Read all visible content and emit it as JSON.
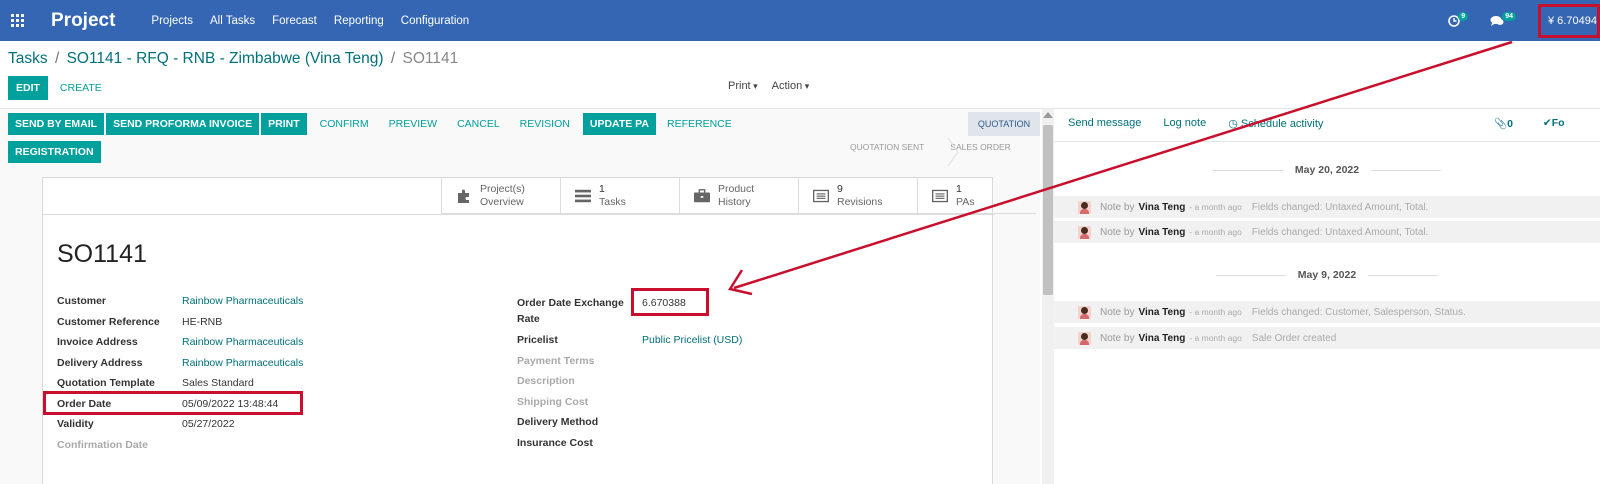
{
  "navbar": {
    "brand": "Project",
    "menu": [
      "Projects",
      "All Tasks",
      "Forecast",
      "Reporting",
      "Configuration"
    ],
    "activity_badge": "9",
    "messages_badge": "94",
    "currency_rate": "¥ 6.70494"
  },
  "breadcrumb": {
    "items": [
      "Tasks",
      "SO1141 - RFQ - RNB - Zimbabwe (Vina Teng)"
    ],
    "current": "SO1141"
  },
  "controls": {
    "edit": "EDIT",
    "create": "CREATE",
    "print": "Print",
    "action": "Action"
  },
  "header_buttons": {
    "send_by_email": "SEND BY EMAIL",
    "send_proforma": "SEND PROFORMA INVOICE",
    "print": "PRINT",
    "confirm": "CONFIRM",
    "preview": "PREVIEW",
    "cancel": "CANCEL",
    "revision": "REVISION",
    "update_pa": "UPDATE PA",
    "reference": "REFERENCE",
    "registration": "REGISTRATION"
  },
  "status": {
    "current": "QUOTATION",
    "stages": [
      "QUOTATION SENT",
      "SALES ORDER"
    ]
  },
  "smart_buttons": [
    {
      "num": "",
      "label1": "Project(s)",
      "label2": "Overview"
    },
    {
      "num": "1",
      "label1": "",
      "label2": "Tasks"
    },
    {
      "num": "",
      "label1": "Product",
      "label2": "History"
    },
    {
      "num": "9",
      "label1": "",
      "label2": "Revisions"
    },
    {
      "num": "1",
      "label1": "",
      "label2": "PAs"
    }
  ],
  "order": {
    "name": "SO1141",
    "left_fields": [
      {
        "label": "Customer",
        "value": "Rainbow Pharmaceuticals"
      },
      {
        "label": "Customer Reference",
        "value": "HE-RNB"
      },
      {
        "label": "Invoice Address",
        "value": "Rainbow Pharmaceuticals"
      },
      {
        "label": "Delivery Address",
        "value": "Rainbow Pharmaceuticals"
      },
      {
        "label": "Quotation Template",
        "value": "Sales Standard"
      },
      {
        "label": "Order Date",
        "value": "05/09/2022 13:48:44"
      },
      {
        "label": "Validity",
        "value": "05/27/2022"
      },
      {
        "label": "Confirmation Date",
        "value": ""
      }
    ],
    "right_fields": {
      "exchange_rate_label_1": "Order Date Exchange",
      "exchange_rate_label_2": "Rate",
      "exchange_rate_value": "6.670388",
      "pricelist_label": "Pricelist",
      "pricelist_value": "Public Pricelist (USD)",
      "payment_terms": "Payment Terms",
      "description": "Description",
      "shipping_cost": "Shipping Cost",
      "delivery_method": "Delivery Method",
      "insurance_cost": "Insurance Cost"
    }
  },
  "chatter": {
    "send_message": "Send message",
    "log_note": "Log note",
    "schedule_activity": "Schedule activity",
    "attachments": "0",
    "follow": "Fo",
    "dates": [
      "May 20, 2022",
      "May 9, 2022"
    ],
    "messages": [
      {
        "prefix": "Note by",
        "author": "Vina Teng",
        "ago": "- a month ago",
        "body": "Fields changed: Untaxed Amount, Total."
      },
      {
        "prefix": "Note by",
        "author": "Vina Teng",
        "ago": "- a month ago",
        "body": "Fields changed: Untaxed Amount, Total."
      },
      {
        "prefix": "Note by",
        "author": "Vina Teng",
        "ago": "- a month ago",
        "body": "Fields changed: Customer, Salesperson, Status."
      },
      {
        "prefix": "Note by",
        "author": "Vina Teng",
        "ago": "- a month ago",
        "body": "Sale Order created"
      }
    ]
  },
  "colors": {
    "navbar": "#3466b3",
    "primary": "#00a09d",
    "link": "#00707a",
    "highlight": "#c8102e"
  }
}
